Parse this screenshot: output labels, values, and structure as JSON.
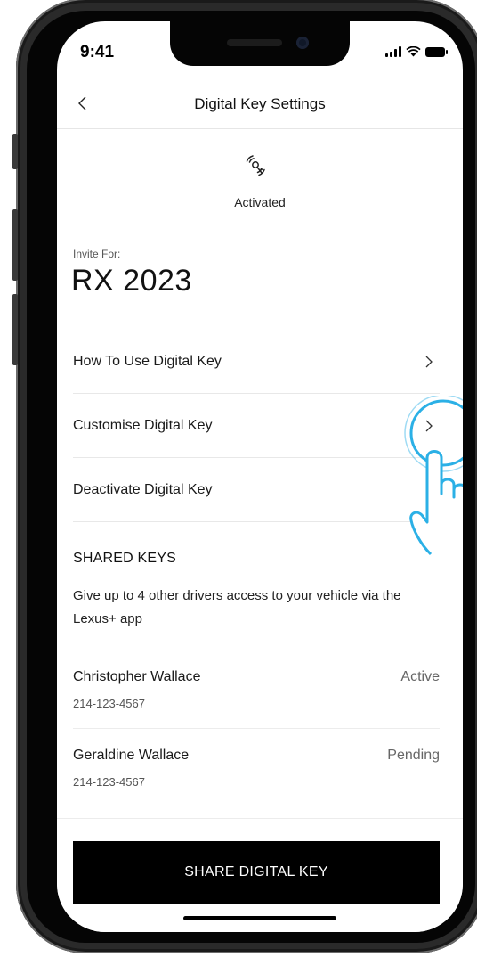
{
  "status_bar": {
    "time": "9:41"
  },
  "nav": {
    "title": "Digital Key Settings"
  },
  "key_status": {
    "label": "Activated"
  },
  "vehicle": {
    "invite_label": "Invite For:",
    "name": "RX 2023"
  },
  "menu": {
    "items": [
      {
        "label": "How To Use Digital Key"
      },
      {
        "label": "Customise Digital Key"
      },
      {
        "label": "Deactivate Digital Key"
      }
    ]
  },
  "shared_keys": {
    "heading": "SHARED KEYS",
    "description": "Give up to 4 other drivers access to your vehicle via the Lexus+ app",
    "keys": [
      {
        "name": "Christopher Wallace",
        "phone": "214-123-4567",
        "status": "Active"
      },
      {
        "name": "Geraldine Wallace",
        "phone": "214-123-4567",
        "status": "Pending"
      }
    ]
  },
  "actions": {
    "share_label": "SHARE DIGITAL KEY"
  },
  "colors": {
    "accent": "#2bb0e6",
    "primary_button": "#000000",
    "text": "#111111"
  },
  "icons": [
    "back-chevron-icon",
    "digital-key-icon",
    "chevron-right-icon",
    "signal-icon",
    "wifi-icon",
    "battery-icon",
    "tap-hand-icon"
  ]
}
